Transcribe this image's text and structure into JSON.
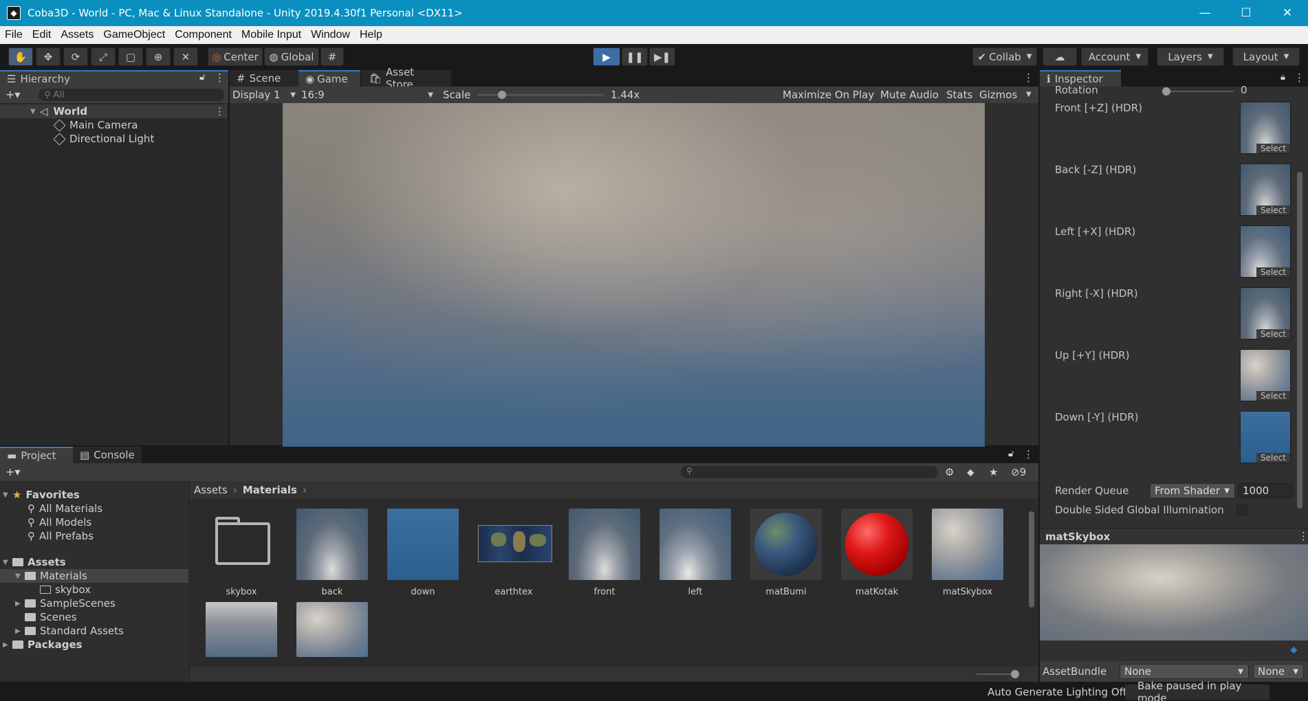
{
  "window": {
    "title": "Coba3D - World - PC, Mac & Linux Standalone - Unity 2019.4.30f1 Personal <DX11>",
    "minimize": "—",
    "maximize": "☐",
    "close": "✕"
  },
  "menu": [
    "File",
    "Edit",
    "Assets",
    "GameObject",
    "Component",
    "Mobile Input",
    "Window",
    "Help"
  ],
  "toolbar": {
    "pivot": "Center",
    "space": "Global",
    "collab": "Collab",
    "account": "Account",
    "layers": "Layers",
    "layout": "Layout"
  },
  "hierarchy": {
    "tab": "Hierarchy",
    "search_placeholder": "All",
    "scene": "World",
    "items": [
      "Main Camera",
      "Directional Light"
    ]
  },
  "center_tabs": [
    "Scene",
    "Game",
    "Asset Store"
  ],
  "game": {
    "display": "Display 1",
    "aspect": "16:9",
    "scale_label": "Scale",
    "scale_value": "1.44x",
    "maximize": "Maximize On Play",
    "mute": "Mute Audio",
    "stats": "Stats",
    "gizmos": "Gizmos"
  },
  "project": {
    "tabs": [
      "Project",
      "Console"
    ],
    "favorites": {
      "label": "Favorites",
      "items": [
        "All Materials",
        "All Models",
        "All Prefabs"
      ]
    },
    "assets": {
      "label": "Assets",
      "materials": "Materials",
      "skybox": "skybox",
      "others": [
        "SampleScenes",
        "Scenes",
        "Standard Assets"
      ]
    },
    "packages": "Packages",
    "breadcrumb": [
      "Assets",
      "Materials"
    ],
    "hidden_count": "9",
    "grid": [
      "skybox",
      "back",
      "down",
      "earthtex",
      "front",
      "left",
      "matBumi",
      "matKotak",
      "matSkybox"
    ]
  },
  "inspector": {
    "tab": "Inspector",
    "rotation_label": "Rotation",
    "rotation_value": "0",
    "faces": [
      "Front [+Z]   (HDR)",
      "Back [-Z]   (HDR)",
      "Left [+X]   (HDR)",
      "Right [-X]   (HDR)",
      "Up [+Y]   (HDR)",
      "Down [-Y]   (HDR)"
    ],
    "select_label": "Select",
    "render_queue_label": "Render Queue",
    "render_queue_mode": "From Shader",
    "render_queue_value": "1000",
    "double_sided": "Double Sided Global Illumination",
    "preview_title": "matSkybox",
    "assetbundle_label": "AssetBundle",
    "assetbundle_value": "None",
    "assetbundle_variant": "None"
  },
  "status": {
    "lighting": "Auto Generate Lighting Off",
    "bake": "Bake paused in play mode"
  },
  "colors": {
    "titlebar": "#0a8fbf",
    "accent": "#3a79bb",
    "panel": "#282828"
  }
}
